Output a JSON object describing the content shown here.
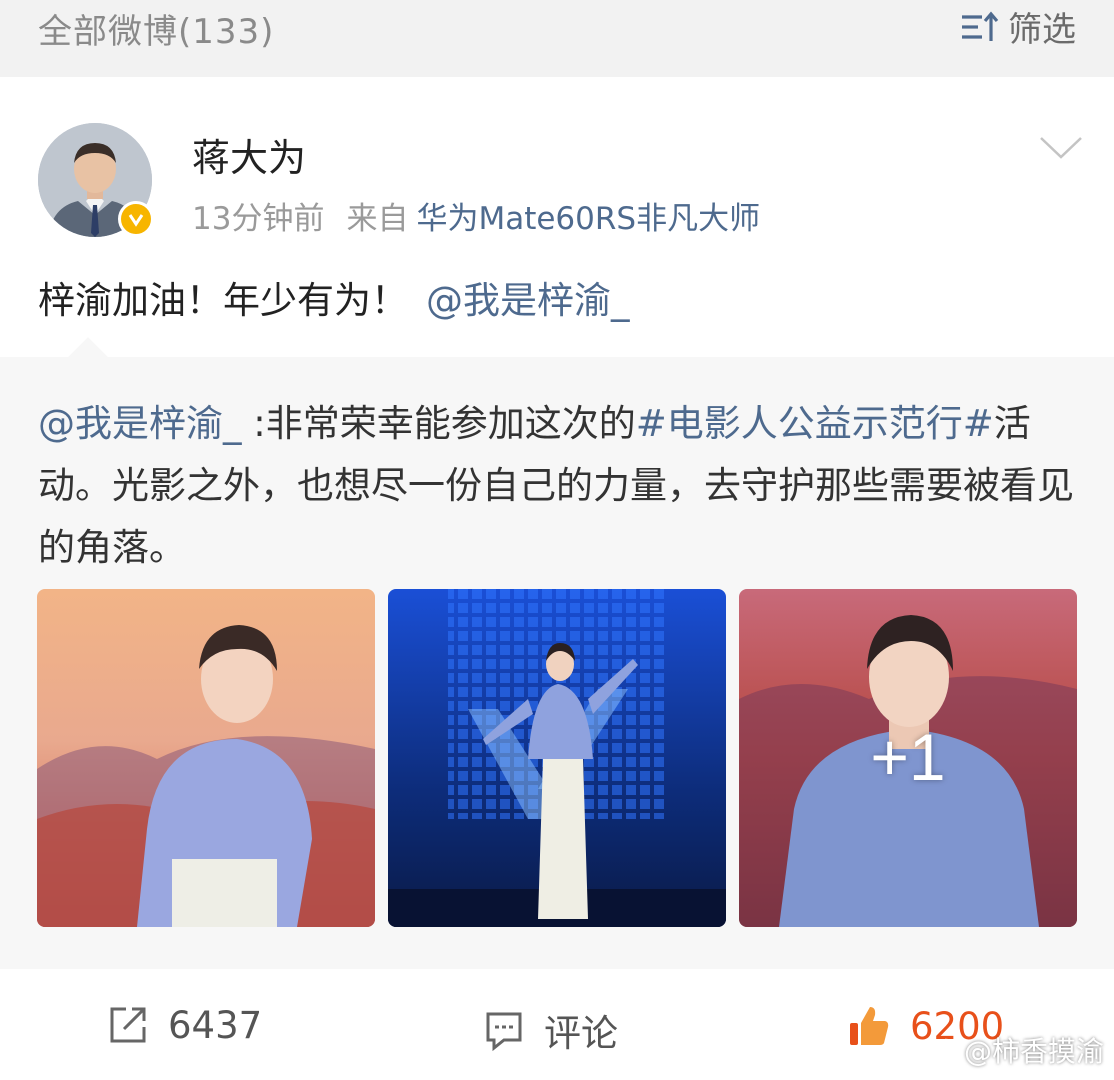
{
  "topbar": {
    "count_label": "全部微博(133)",
    "filter_label": "筛选",
    "filter_icon": "sort-filter-icon"
  },
  "post": {
    "author": "蒋大为",
    "verified": true,
    "time": "13分钟前",
    "from_label": "来自",
    "device": "华为Mate60RS非凡大师",
    "text": "梓渝加油！年少有为！",
    "mention": "@我是梓渝_",
    "more_icon": "chevron-down-icon"
  },
  "repost": {
    "author_mention": "@我是梓渝_",
    "text_part1": " :非常荣幸能参加这次的",
    "hashtag": "#电影人公益示范行#",
    "text_part2": "活动。光影之外，也想尽一份自己的力量，去守护那些需要被看见的角落。",
    "images": [
      {
        "name": "photo-1"
      },
      {
        "name": "photo-2"
      },
      {
        "name": "photo-3",
        "overlay": "+1"
      }
    ]
  },
  "actions": {
    "share_count": "6437",
    "comment_label": "评论",
    "like_count": "6200"
  },
  "watermark": "@柿香摸渝",
  "colors": {
    "link": "#4e6a8e",
    "like": "#e8501a",
    "badge": "#f7b500",
    "muted": "#9a9a9a"
  }
}
